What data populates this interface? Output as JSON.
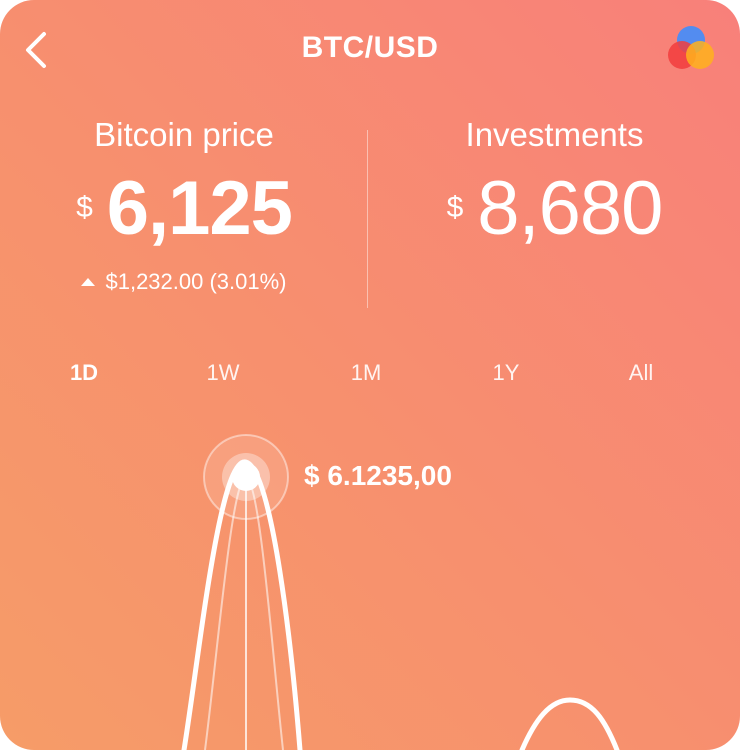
{
  "header": {
    "title": "BTC/USD",
    "back_icon": "chevron-left-icon",
    "app_icon": "overlapping-circles-logo"
  },
  "bitcoin": {
    "label": "Bitcoin price",
    "currency": "$",
    "value": "6,125",
    "change": "$1,232.00 (3.01%)",
    "change_direction": "up"
  },
  "investments": {
    "label": "Investments",
    "currency": "$",
    "value": "8,680"
  },
  "ranges": {
    "items": [
      {
        "label": "1D",
        "active": true
      },
      {
        "label": "1W",
        "active": false
      },
      {
        "label": "1M",
        "active": false
      },
      {
        "label": "1Y",
        "active": false
      },
      {
        "label": "All",
        "active": false
      }
    ]
  },
  "chart": {
    "tooltip": "$ 6.1235,00"
  },
  "colors": {
    "gradient_start": "#f8807a",
    "gradient_end": "#f69c68",
    "foreground": "#ffffff"
  }
}
